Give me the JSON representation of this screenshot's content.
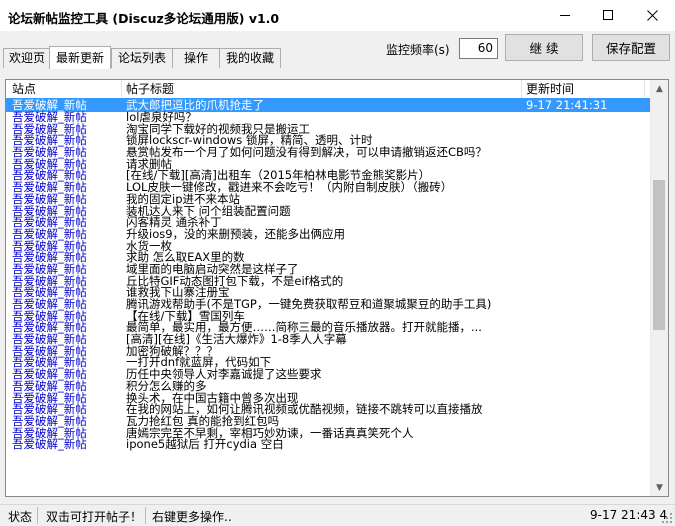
{
  "window": {
    "title": "论坛新帖监控工具 (Discuz多论坛通用版) v1.0"
  },
  "tabs": [
    {
      "label": "欢迎页",
      "active": false
    },
    {
      "label": "最新更新",
      "active": true
    },
    {
      "label": "论坛列表",
      "active": false
    },
    {
      "label": "操作",
      "active": false
    },
    {
      "label": "我的收藏",
      "active": false
    }
  ],
  "controls": {
    "freq_label": "监控频率(s)",
    "freq_value": "60",
    "continue_label": "继 续",
    "save_label": "保存配置"
  },
  "table": {
    "columns": [
      "站点",
      "帖子标题",
      "更新时间"
    ],
    "rows": [
      {
        "site": "吾爱破解_新帖",
        "title": "武大郎把逗比的爪机抢走了",
        "time": "9-17 21:41:31",
        "selected": true
      },
      {
        "site": "吾爱破解_新帖",
        "title": "lol虐泉好吗？",
        "time": ""
      },
      {
        "site": "吾爱破解_新帖",
        "title": "淘宝同学下载好的视频我只是搬运工",
        "time": ""
      },
      {
        "site": "吾爱破解_新帖",
        "title": "锁屏lockscr-windows 锁屏，精简、透明、计时",
        "time": ""
      },
      {
        "site": "吾爱破解_新帖",
        "title": "悬赏帖发布一个月了如何问题没有得到解决，可以申请撤销返还CB吗？",
        "time": ""
      },
      {
        "site": "吾爱破解_新帖",
        "title": "请求删帖",
        "time": ""
      },
      {
        "site": "吾爱破解_新帖",
        "title": "[在线/下载][高清]出租车（2015年柏林电影节金熊奖影片）",
        "time": ""
      },
      {
        "site": "吾爱破解_新帖",
        "title": "LOL皮肤一键修改，戳进来不会吃亏！（内附自制皮肤）（搬砖）",
        "time": ""
      },
      {
        "site": "吾爱破解_新帖",
        "title": "我的固定ip进不来本站",
        "time": ""
      },
      {
        "site": "吾爱破解_新帖",
        "title": "装机达人来下 问个组装配置问题",
        "time": ""
      },
      {
        "site": "吾爱破解_新帖",
        "title": "闪客精灵 通杀补丁",
        "time": ""
      },
      {
        "site": "吾爱破解_新帖",
        "title": "升级ios9，没的来删预装，还能多出俩应用",
        "time": ""
      },
      {
        "site": "吾爱破解_新帖",
        "title": "水货一枚",
        "time": ""
      },
      {
        "site": "吾爱破解_新帖",
        "title": "求助  怎么取EAX里的数",
        "time": ""
      },
      {
        "site": "吾爱破解_新帖",
        "title": "域里面的电脑启动突然是这样子了",
        "time": ""
      },
      {
        "site": "吾爱破解_新帖",
        "title": "丘比特GIF动态图打包下载，不是eif格式的",
        "time": ""
      },
      {
        "site": "吾爱破解_新帖",
        "title": "谁救我下山寨注册宝",
        "time": ""
      },
      {
        "site": "吾爱破解_新帖",
        "title": "腾讯游戏帮助手(不是TGP，一键免费获取帮豆和道聚城聚豆的助手工具)",
        "time": ""
      },
      {
        "site": "吾爱破解_新帖",
        "title": "【在线/下载】雪国列车",
        "time": ""
      },
      {
        "site": "吾爱破解_新帖",
        "title": "最简单，最实用，最方便……简称三最的音乐播放器。打开就能播，...",
        "time": ""
      },
      {
        "site": "吾爱破解_新帖",
        "title": "[高清][在线]《生活大爆炸》1-8季人人字幕",
        "time": ""
      },
      {
        "site": "吾爱破解_新帖",
        "title": "加密狗破解？？？",
        "time": ""
      },
      {
        "site": "吾爱破解_新帖",
        "title": "一打开dnf就蓝屏，代码如下",
        "time": ""
      },
      {
        "site": "吾爱破解_新帖",
        "title": "历任中央领导人对李嘉诚提了这些要求",
        "time": ""
      },
      {
        "site": "吾爱破解_新帖",
        "title": "积分怎么赚的多",
        "time": ""
      },
      {
        "site": "吾爱破解_新帖",
        "title": "换头术，在中国古籍中曾多次出现",
        "time": ""
      },
      {
        "site": "吾爱破解_新帖",
        "title": "在我的网站上，如何让腾讯视频或优酷视频，链接不跳转可以直接播放",
        "time": ""
      },
      {
        "site": "吾爱破解_新帖",
        "title": "瓦力抢红包     真的能抢到红包吗",
        "time": ""
      },
      {
        "site": "吾爱破解_新帖",
        "title": "唐嫣宗完至不早剩，宰相巧妙劝谏，一番话真真笑死个人",
        "time": ""
      },
      {
        "site": "吾爱破解_新帖",
        "title": "ipone5越狱后 打开cydia  空白",
        "time": ""
      }
    ]
  },
  "status": {
    "label": "状态",
    "hint1": "双击可打开帖子！",
    "hint2": "右键更多操作..",
    "clock": "9-17 21:43 4"
  }
}
